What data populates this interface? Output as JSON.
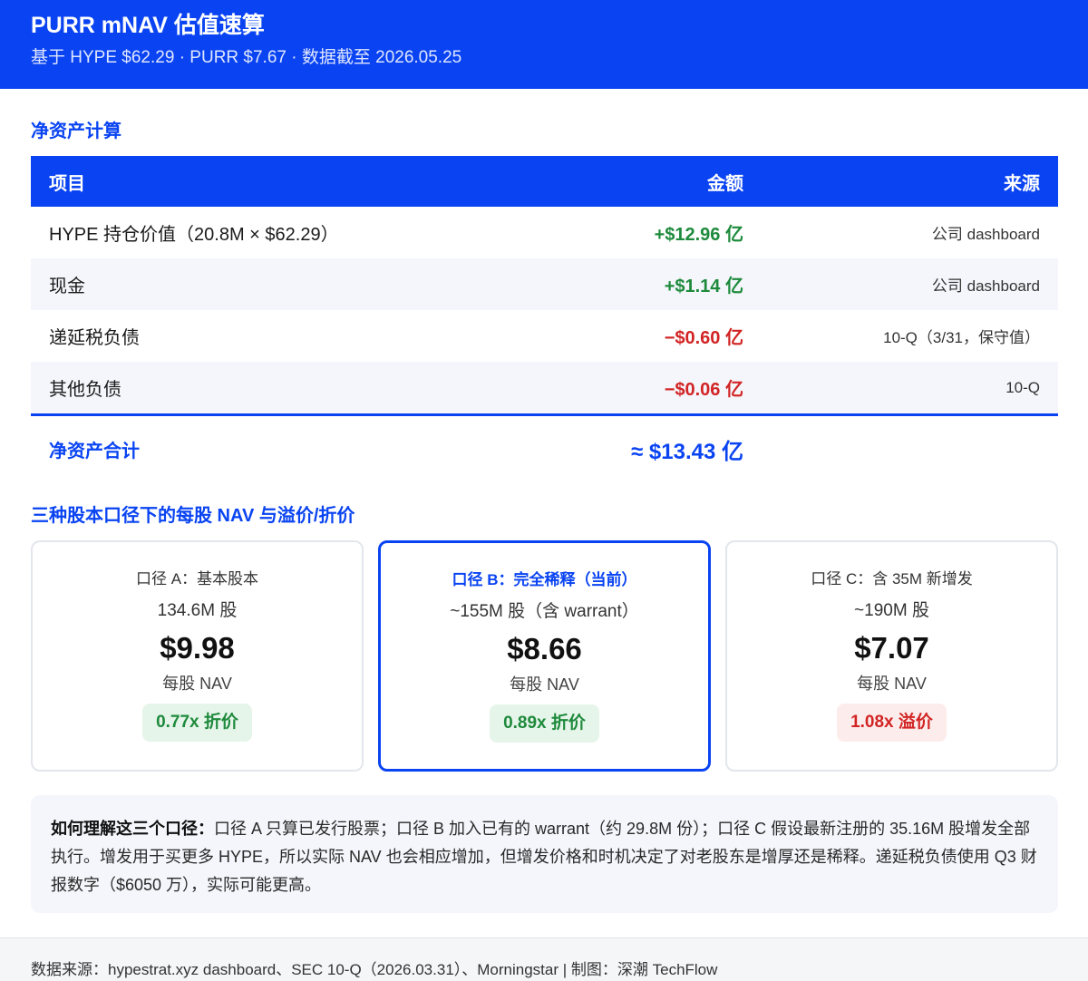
{
  "header": {
    "title": "PURR mNAV 估值速算",
    "subtitle": "基于 HYPE $62.29 · PURR $7.67 · 数据截至 2026.05.25"
  },
  "nav_section": {
    "title": "净资产计算",
    "columns": [
      "项目",
      "金额",
      "来源"
    ],
    "rows": [
      {
        "item": "HYPE 持仓价值（20.8M × $62.29）",
        "amount": "+$12.96 亿",
        "source": "公司 dashboard",
        "sign": "positive"
      },
      {
        "item": "现金",
        "amount": "+$1.14 亿",
        "source": "公司 dashboard",
        "sign": "positive"
      },
      {
        "item": "递延税负债",
        "amount": "−$0.60 亿",
        "source": "10-Q（3/31，保守值）",
        "sign": "negative"
      },
      {
        "item": "其他负债",
        "amount": "−$0.06 亿",
        "source": "10-Q",
        "sign": "negative"
      }
    ],
    "total_label": "净资产合计",
    "total_value": "≈ $13.43 亿"
  },
  "scenarios": {
    "title": "三种股本口径下的每股 NAV 与溢价/折价",
    "cards": [
      {
        "label": "口径 A：基本股本",
        "shares": "134.6M 股",
        "price": "$9.98",
        "nav_label": "每股 NAV",
        "badge": "0.77x 折价",
        "badge_type": "discount",
        "current": false
      },
      {
        "label": "口径 B：完全稀释（当前）",
        "shares": "~155M 股（含 warrant）",
        "price": "$8.66",
        "nav_label": "每股 NAV",
        "badge": "0.89x 折价",
        "badge_type": "discount",
        "current": true
      },
      {
        "label": "口径 C：含 35M 新增发",
        "shares": "~190M 股",
        "price": "$7.07",
        "nav_label": "每股 NAV",
        "badge": "1.08x 溢价",
        "badge_type": "premium",
        "current": false
      }
    ]
  },
  "note": {
    "heading": "如何理解这三个口径：",
    "body": "口径 A 只算已发行股票；口径 B 加入已有的 warrant（约 29.8M 份）；口径 C 假设最新注册的 35.16M 股增发全部执行。增发用于买更多 HYPE，所以实际 NAV 也会相应增加，但增发价格和时机决定了对老股东是增厚还是稀释。递延税负债使用 Q3 财报数字（$6050 万），实际可能更高。"
  },
  "footer": {
    "text": "数据来源：hypestrat.xyz dashboard、SEC 10-Q（2026.03.31）、Morningstar | 制图：深潮 TechFlow"
  },
  "colors": {
    "brand_blue": "#0a44f2",
    "positive_green": "#1e8a3c",
    "negative_red": "#d22424"
  }
}
